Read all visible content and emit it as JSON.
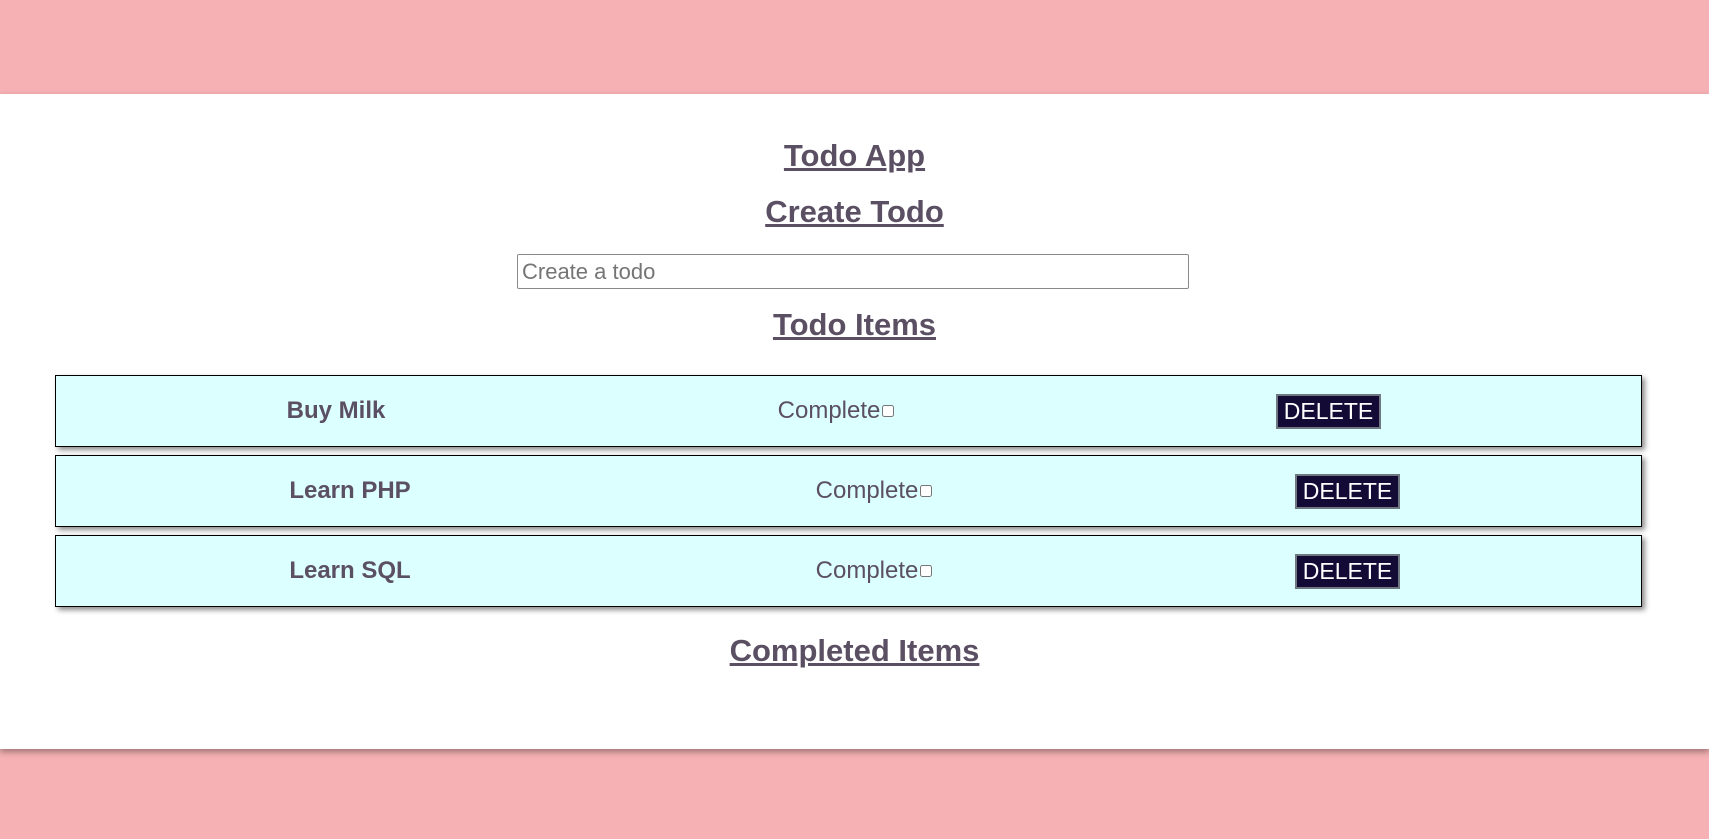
{
  "app": {
    "title": "Todo App"
  },
  "create": {
    "heading": "Create Todo",
    "placeholder": "Create a todo",
    "value": ""
  },
  "todo_items": {
    "heading": "Todo Items",
    "items": [
      {
        "title": "Buy Milk",
        "complete_label": "Complete",
        "checked": false,
        "delete_label": "DELETE"
      },
      {
        "title": "Learn PHP",
        "complete_label": "Complete",
        "checked": false,
        "delete_label": "DELETE"
      },
      {
        "title": "Learn SQL",
        "complete_label": "Complete",
        "checked": false,
        "delete_label": "DELETE"
      }
    ]
  },
  "completed_items": {
    "heading": "Completed Items",
    "items": []
  },
  "colors": {
    "page_background": "#f5b1b3",
    "card_background": "#ffffff",
    "row_background": "#dcffff",
    "text": "#5b4f63",
    "button_background": "#130a36"
  }
}
